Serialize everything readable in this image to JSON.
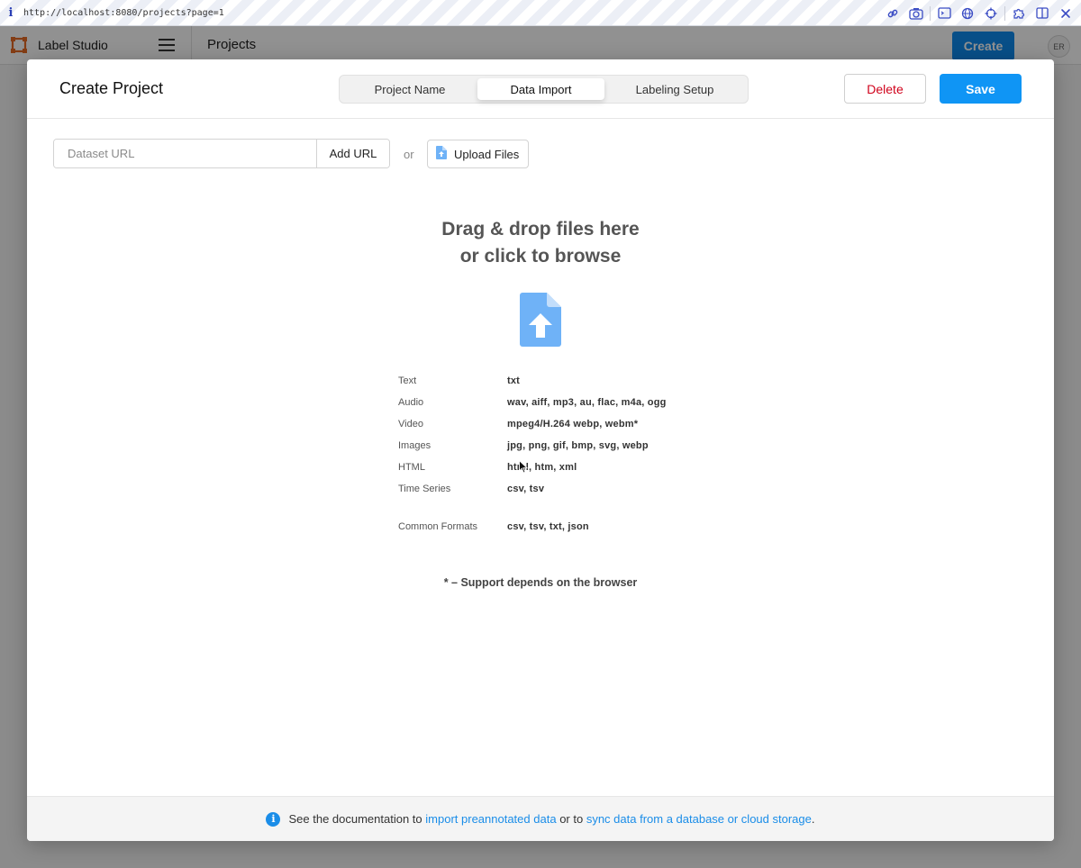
{
  "browser": {
    "url": "http://localhost:8080/projects?page=1",
    "icons": [
      "link-icon",
      "camera-icon",
      "terminal-icon",
      "globe-icon",
      "crosshair-icon",
      "extension-icon",
      "split-view-icon",
      "close-icon"
    ]
  },
  "app": {
    "name": "Label Studio",
    "page_title": "Projects",
    "create_label": "Create",
    "avatar_initials": "ER"
  },
  "modal": {
    "title": "Create Project",
    "tabs": [
      {
        "label": "Project Name"
      },
      {
        "label": "Data Import",
        "active": true
      },
      {
        "label": "Labeling Setup"
      }
    ],
    "delete_label": "Delete",
    "save_label": "Save",
    "url_input": {
      "placeholder": "Dataset URL",
      "value": ""
    },
    "add_url_label": "Add URL",
    "or_text": "or",
    "upload_label": "Upload Files",
    "drop_title_line1": "Drag & drop files here",
    "drop_title_line2": "or click to browse",
    "formats": [
      {
        "label": "Text",
        "value": "txt"
      },
      {
        "label": "Audio",
        "value": "wav, aiff, mp3, au, flac, m4a, ogg"
      },
      {
        "label": "Video",
        "value": "mpeg4/H.264 webp, webm*"
      },
      {
        "label": "Images",
        "value": "jpg, png, gif, bmp, svg, webp"
      },
      {
        "label": "HTML",
        "value": "html, htm, xml"
      },
      {
        "label": "Time Series",
        "value": "csv, tsv"
      },
      {
        "label": "Common Formats",
        "value": "csv, tsv, txt, json"
      }
    ],
    "support_note": "* – Support depends on the browser",
    "footer": {
      "text1": "See the documentation to",
      "link1": "import preannotated data",
      "text2": "or to",
      "link2": "sync data from a database or cloud storage",
      "text3": "."
    }
  },
  "colors": {
    "accent": "#0f95f5",
    "delete": "#d0021b",
    "link": "#1a8de8",
    "upload_icon": "#6fb2f7"
  }
}
